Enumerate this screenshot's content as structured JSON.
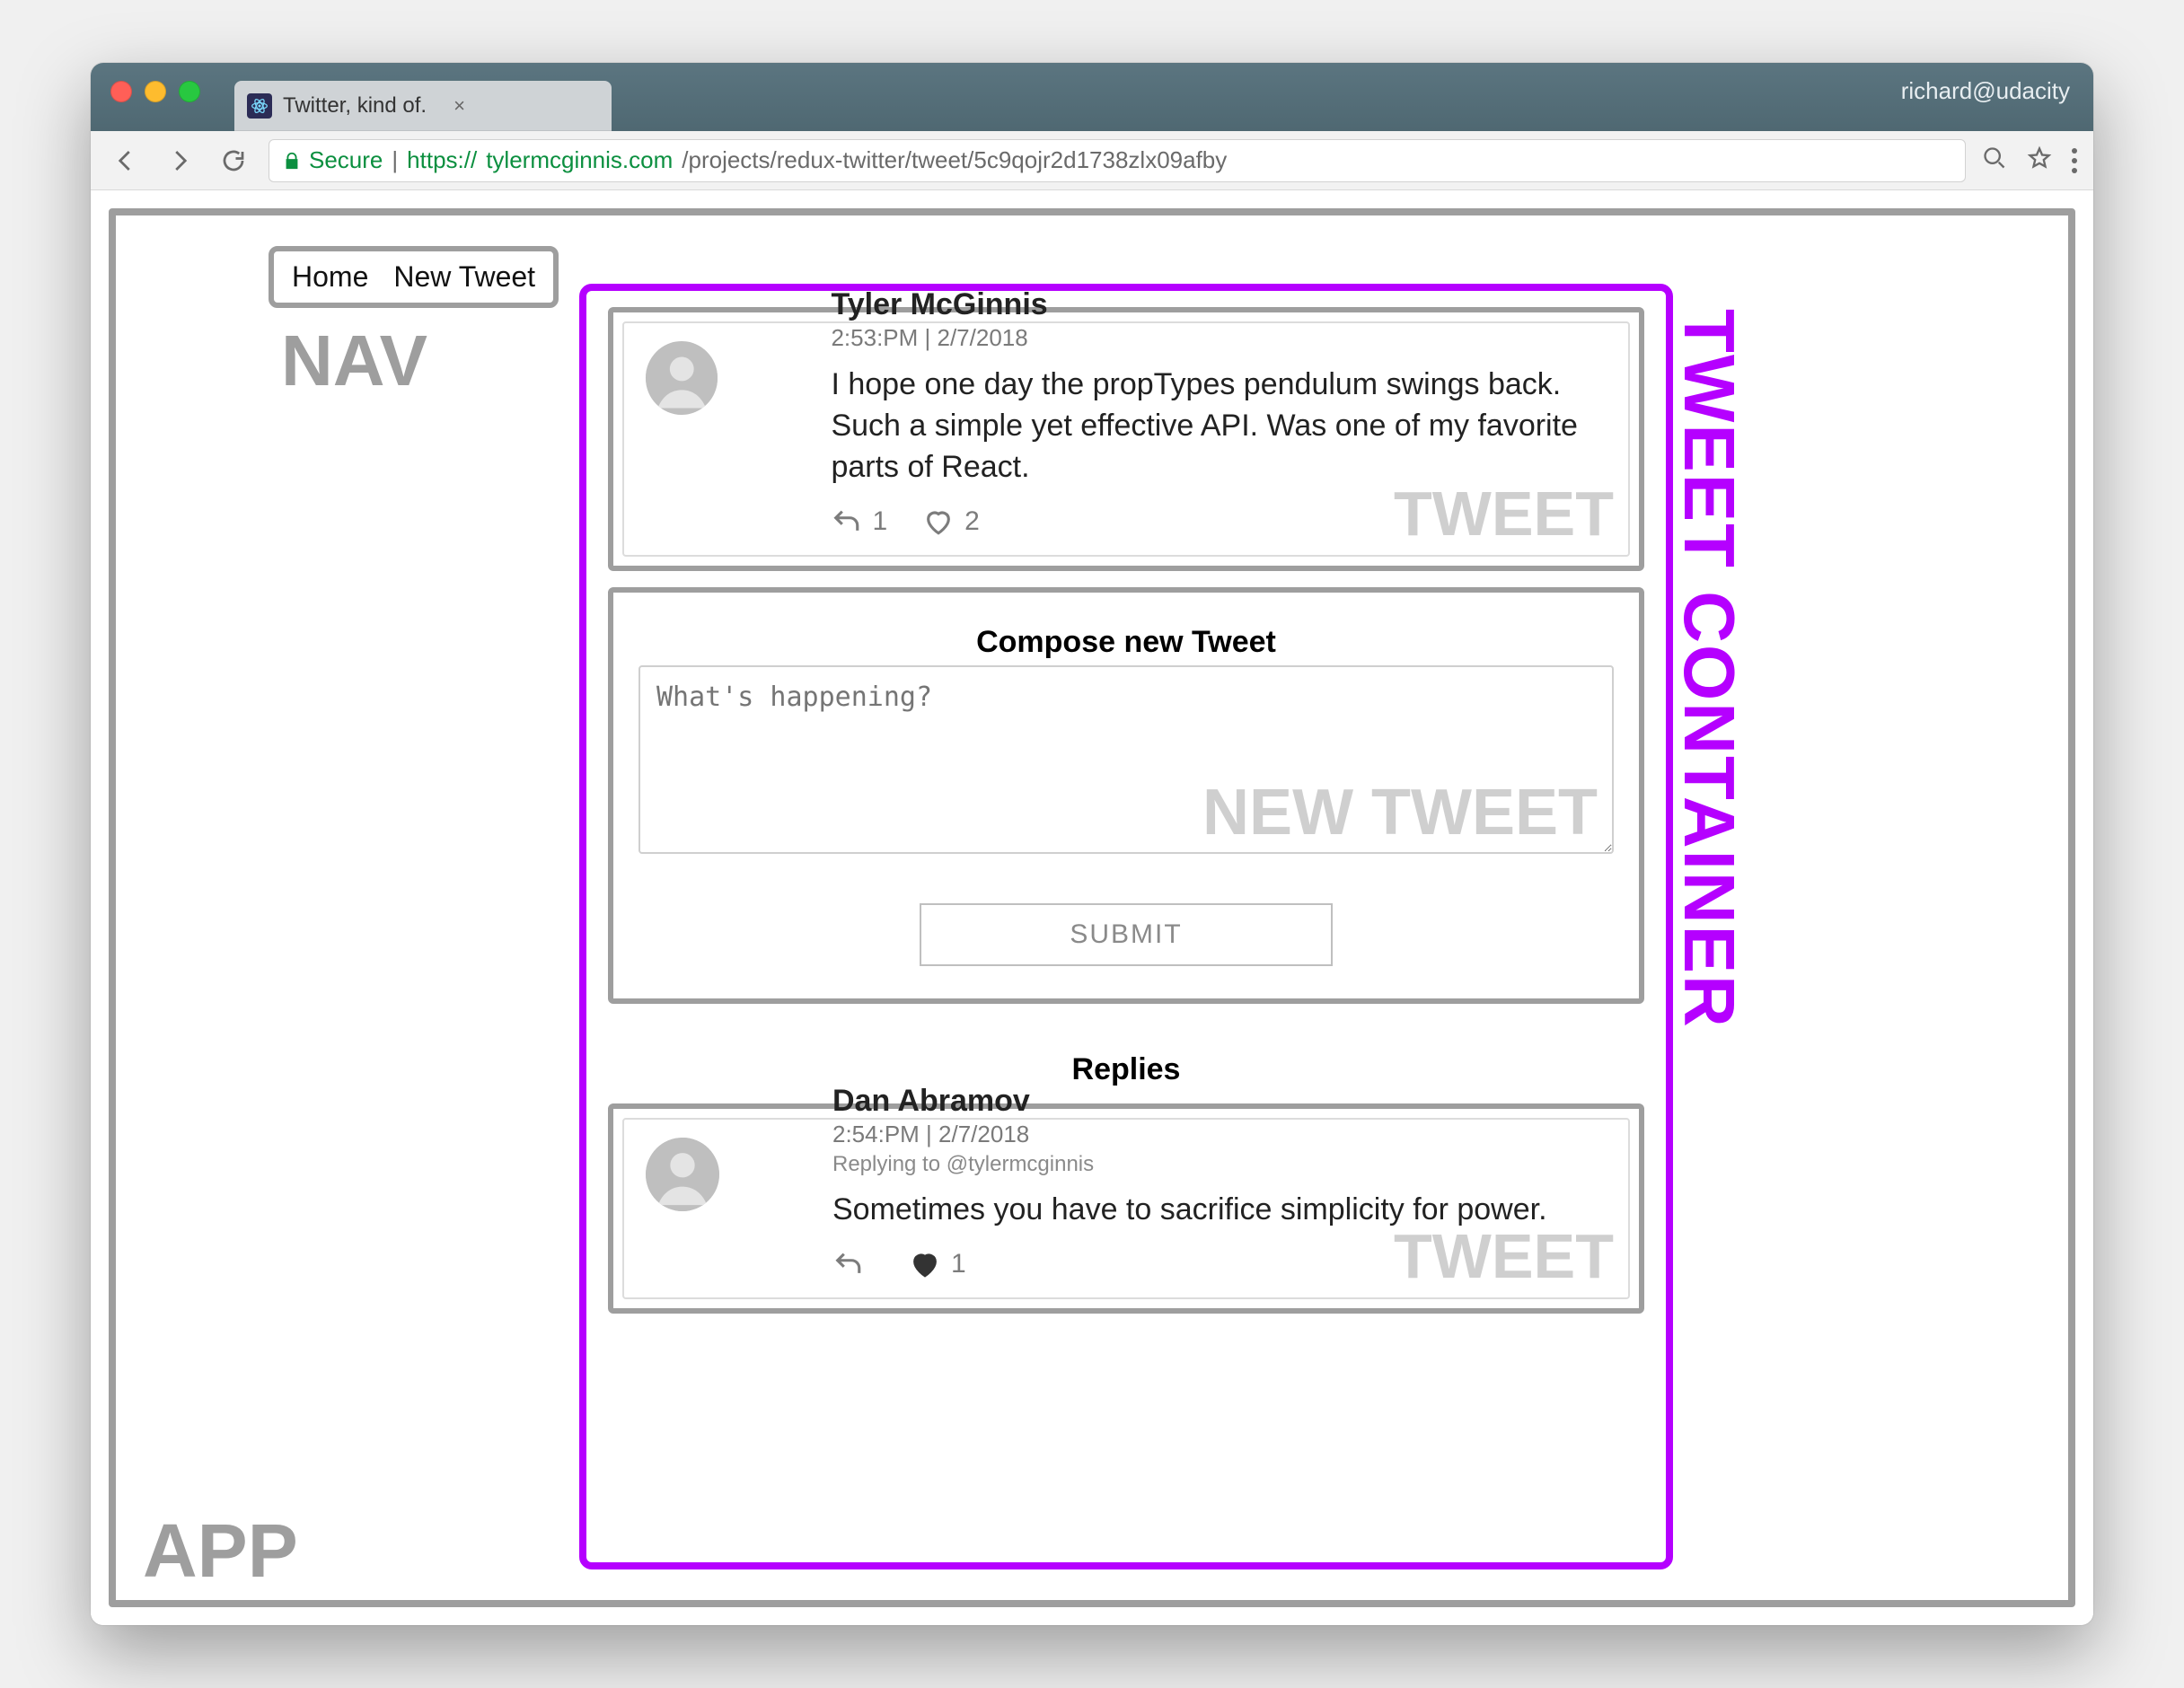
{
  "browser": {
    "tab_title": "Twitter, kind of.",
    "profile": "richard@udacity",
    "secure_label": "Secure",
    "url_prefix": "https://",
    "url_host": "tylermcginnis.com",
    "url_path": "/projects/redux-twitter/tweet/5c9qojr2d1738zlx09afby"
  },
  "labels": {
    "app": "APP",
    "nav": "NAV",
    "tweet_container": "TWEET CONTAINER",
    "tweet": "TWEET",
    "new_tweet": "NEW TWEET"
  },
  "nav": {
    "home": "Home",
    "new_tweet": "New Tweet"
  },
  "main_tweet": {
    "author": "Tyler McGinnis",
    "meta": "2:53:PM | 2/7/2018",
    "text": "I hope one day the propTypes pendulum swings back. Such a simple yet effective API. Was one of my favorite parts of React.",
    "reply_count": "1",
    "like_count": "2"
  },
  "compose": {
    "title": "Compose new Tweet",
    "placeholder": "What's happening?",
    "submit": "SUBMIT"
  },
  "replies": {
    "title": "Replies",
    "items": [
      {
        "author": "Dan Abramov",
        "meta": "2:54:PM | 2/7/2018",
        "replying_to": "Replying to @tylermcginnis",
        "text": "Sometimes you have to sacrifice simplicity for power.",
        "reply_count": "",
        "like_count": "1"
      }
    ]
  }
}
